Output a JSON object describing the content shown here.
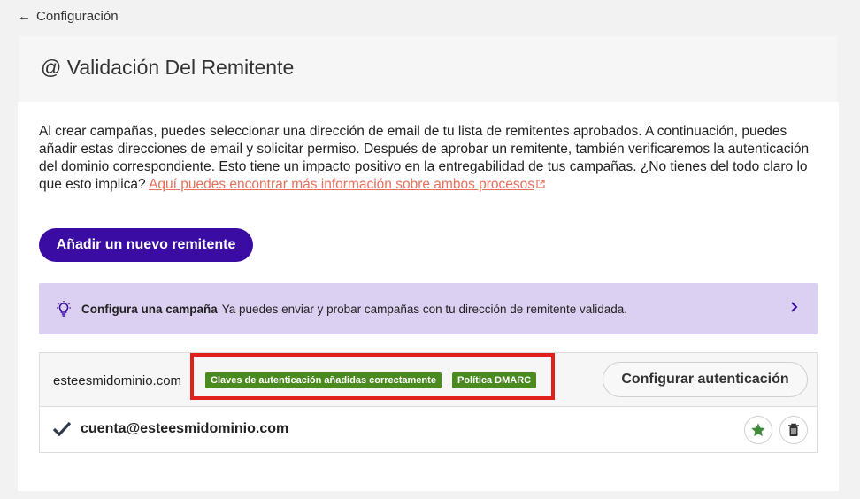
{
  "nav": {
    "back_label": "Configuración"
  },
  "header": {
    "title": "@ Validación Del Remitente"
  },
  "intro": {
    "text": "Al crear campañas, puedes seleccionar una dirección de email de tu lista de remitentes aprobados. A continuación, puedes añadir estas direcciones de email y solicitar permiso. Después de aprobar un remitente, también verificaremos la autenticación del dominio correspondiente. Esto tiene un impacto positivo en la entregabilidad de tus campañas. ¿No tienes del todo claro lo que esto implica? ",
    "link_text": "Aquí puedes encontrar más información sobre ambos procesos"
  },
  "actions": {
    "add_sender_label": "Añadir un nuevo remitente"
  },
  "banner": {
    "title": "Configura una campaña",
    "text": "Ya puedes enviar y probar campañas con tu dirección de remitente validada.",
    "icon": "lightbulb-icon"
  },
  "domain": {
    "name": "esteesmidominio.com",
    "badges": [
      "Claves de autenticación añadidas correctamente",
      "Política DMARC"
    ],
    "configure_label": "Configurar autenticación",
    "senders": [
      {
        "email": "cuenta@esteesmidominio.com"
      }
    ]
  },
  "colors": {
    "primary": "#3a0ca3",
    "banner_bg": "#dcd0f2",
    "badge_green": "#4a8a1e",
    "link": "#e8705a",
    "highlight_red": "#e0201c"
  }
}
